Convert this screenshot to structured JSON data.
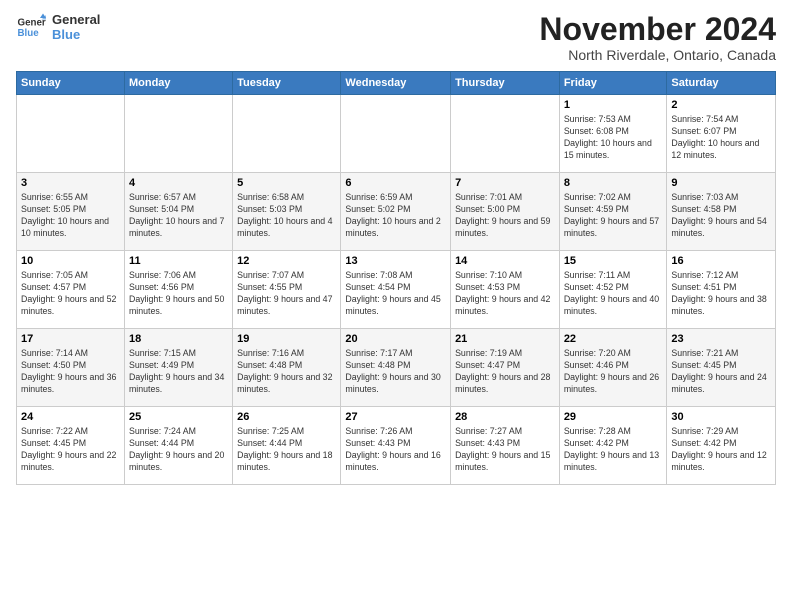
{
  "logo": {
    "line1": "General",
    "line2": "Blue"
  },
  "title": "November 2024",
  "location": "North Riverdale, Ontario, Canada",
  "days_header": [
    "Sunday",
    "Monday",
    "Tuesday",
    "Wednesday",
    "Thursday",
    "Friday",
    "Saturday"
  ],
  "weeks": [
    [
      {
        "num": "",
        "info": ""
      },
      {
        "num": "",
        "info": ""
      },
      {
        "num": "",
        "info": ""
      },
      {
        "num": "",
        "info": ""
      },
      {
        "num": "",
        "info": ""
      },
      {
        "num": "1",
        "info": "Sunrise: 7:53 AM\nSunset: 6:08 PM\nDaylight: 10 hours and 15 minutes."
      },
      {
        "num": "2",
        "info": "Sunrise: 7:54 AM\nSunset: 6:07 PM\nDaylight: 10 hours and 12 minutes."
      }
    ],
    [
      {
        "num": "3",
        "info": "Sunrise: 6:55 AM\nSunset: 5:05 PM\nDaylight: 10 hours and 10 minutes."
      },
      {
        "num": "4",
        "info": "Sunrise: 6:57 AM\nSunset: 5:04 PM\nDaylight: 10 hours and 7 minutes."
      },
      {
        "num": "5",
        "info": "Sunrise: 6:58 AM\nSunset: 5:03 PM\nDaylight: 10 hours and 4 minutes."
      },
      {
        "num": "6",
        "info": "Sunrise: 6:59 AM\nSunset: 5:02 PM\nDaylight: 10 hours and 2 minutes."
      },
      {
        "num": "7",
        "info": "Sunrise: 7:01 AM\nSunset: 5:00 PM\nDaylight: 9 hours and 59 minutes."
      },
      {
        "num": "8",
        "info": "Sunrise: 7:02 AM\nSunset: 4:59 PM\nDaylight: 9 hours and 57 minutes."
      },
      {
        "num": "9",
        "info": "Sunrise: 7:03 AM\nSunset: 4:58 PM\nDaylight: 9 hours and 54 minutes."
      }
    ],
    [
      {
        "num": "10",
        "info": "Sunrise: 7:05 AM\nSunset: 4:57 PM\nDaylight: 9 hours and 52 minutes."
      },
      {
        "num": "11",
        "info": "Sunrise: 7:06 AM\nSunset: 4:56 PM\nDaylight: 9 hours and 50 minutes."
      },
      {
        "num": "12",
        "info": "Sunrise: 7:07 AM\nSunset: 4:55 PM\nDaylight: 9 hours and 47 minutes."
      },
      {
        "num": "13",
        "info": "Sunrise: 7:08 AM\nSunset: 4:54 PM\nDaylight: 9 hours and 45 minutes."
      },
      {
        "num": "14",
        "info": "Sunrise: 7:10 AM\nSunset: 4:53 PM\nDaylight: 9 hours and 42 minutes."
      },
      {
        "num": "15",
        "info": "Sunrise: 7:11 AM\nSunset: 4:52 PM\nDaylight: 9 hours and 40 minutes."
      },
      {
        "num": "16",
        "info": "Sunrise: 7:12 AM\nSunset: 4:51 PM\nDaylight: 9 hours and 38 minutes."
      }
    ],
    [
      {
        "num": "17",
        "info": "Sunrise: 7:14 AM\nSunset: 4:50 PM\nDaylight: 9 hours and 36 minutes."
      },
      {
        "num": "18",
        "info": "Sunrise: 7:15 AM\nSunset: 4:49 PM\nDaylight: 9 hours and 34 minutes."
      },
      {
        "num": "19",
        "info": "Sunrise: 7:16 AM\nSunset: 4:48 PM\nDaylight: 9 hours and 32 minutes."
      },
      {
        "num": "20",
        "info": "Sunrise: 7:17 AM\nSunset: 4:48 PM\nDaylight: 9 hours and 30 minutes."
      },
      {
        "num": "21",
        "info": "Sunrise: 7:19 AM\nSunset: 4:47 PM\nDaylight: 9 hours and 28 minutes."
      },
      {
        "num": "22",
        "info": "Sunrise: 7:20 AM\nSunset: 4:46 PM\nDaylight: 9 hours and 26 minutes."
      },
      {
        "num": "23",
        "info": "Sunrise: 7:21 AM\nSunset: 4:45 PM\nDaylight: 9 hours and 24 minutes."
      }
    ],
    [
      {
        "num": "24",
        "info": "Sunrise: 7:22 AM\nSunset: 4:45 PM\nDaylight: 9 hours and 22 minutes."
      },
      {
        "num": "25",
        "info": "Sunrise: 7:24 AM\nSunset: 4:44 PM\nDaylight: 9 hours and 20 minutes."
      },
      {
        "num": "26",
        "info": "Sunrise: 7:25 AM\nSunset: 4:44 PM\nDaylight: 9 hours and 18 minutes."
      },
      {
        "num": "27",
        "info": "Sunrise: 7:26 AM\nSunset: 4:43 PM\nDaylight: 9 hours and 16 minutes."
      },
      {
        "num": "28",
        "info": "Sunrise: 7:27 AM\nSunset: 4:43 PM\nDaylight: 9 hours and 15 minutes."
      },
      {
        "num": "29",
        "info": "Sunrise: 7:28 AM\nSunset: 4:42 PM\nDaylight: 9 hours and 13 minutes."
      },
      {
        "num": "30",
        "info": "Sunrise: 7:29 AM\nSunset: 4:42 PM\nDaylight: 9 hours and 12 minutes."
      }
    ]
  ]
}
